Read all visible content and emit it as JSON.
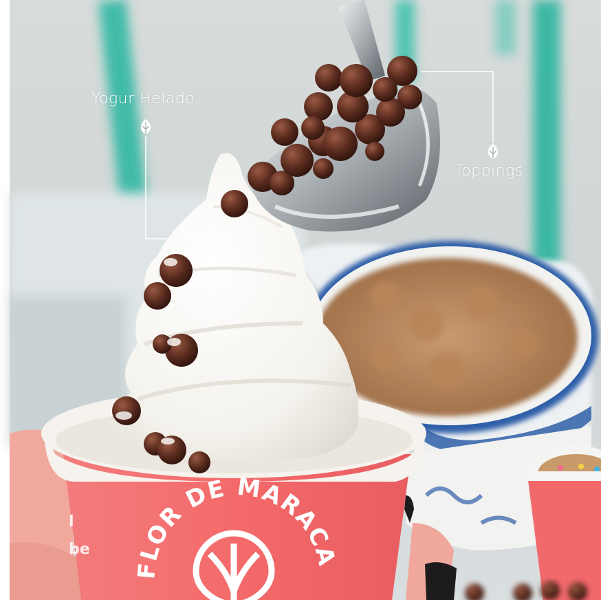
{
  "callouts": {
    "yogurt_label": "Yogur Helado",
    "toppings_label": "Toppings"
  },
  "cup": {
    "brand_text": "FLOR DE MARACA",
    "cup_color": "#f26b6b"
  },
  "colors": {
    "background_teal": "#2fb7a3",
    "callout_line": "#ffffff",
    "chocolate": "#5a2d20",
    "granola_bowl_rim": "#2f5fa8"
  },
  "icons": [
    "leaf-icon",
    "flower-logo-icon"
  ]
}
